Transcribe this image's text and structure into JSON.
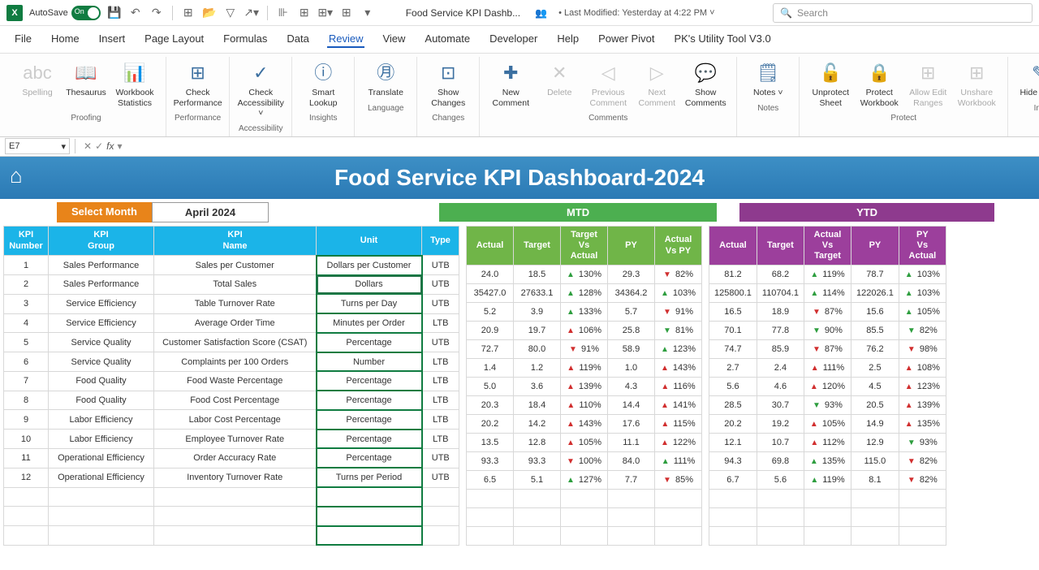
{
  "titlebar": {
    "autosave": "AutoSave",
    "doc": "Food Service KPI Dashb...",
    "lastmod": "• Last Modified: Yesterday at 4:22 PM",
    "search_ph": "Search"
  },
  "menu": [
    "File",
    "Home",
    "Insert",
    "Page Layout",
    "Formulas",
    "Data",
    "Review",
    "View",
    "Automate",
    "Developer",
    "Help",
    "Power Pivot",
    "PK's Utility Tool V3.0"
  ],
  "menu_active": "Review",
  "ribbon": {
    "groups": [
      {
        "label": "Proofing",
        "buttons": [
          {
            "icon": "abc",
            "label": "Spelling",
            "d": true
          },
          {
            "icon": "📖",
            "label": "Thesaurus"
          },
          {
            "icon": "📊",
            "label": "Workbook Statistics"
          }
        ]
      },
      {
        "label": "Performance",
        "buttons": [
          {
            "icon": "⊞",
            "label": "Check Performance"
          }
        ]
      },
      {
        "label": "Accessibility",
        "buttons": [
          {
            "icon": "✓",
            "label": "Check Accessibility ˅"
          }
        ]
      },
      {
        "label": "Insights",
        "buttons": [
          {
            "icon": "ⓘ",
            "label": "Smart Lookup"
          }
        ]
      },
      {
        "label": "Language",
        "buttons": [
          {
            "icon": "㊊",
            "label": "Translate"
          }
        ]
      },
      {
        "label": "Changes",
        "buttons": [
          {
            "icon": "⊡",
            "label": "Show Changes"
          }
        ]
      },
      {
        "label": "Comments",
        "buttons": [
          {
            "icon": "✚",
            "label": "New Comment"
          },
          {
            "icon": "✕",
            "label": "Delete",
            "d": true
          },
          {
            "icon": "◁",
            "label": "Previous Comment",
            "d": true
          },
          {
            "icon": "▷",
            "label": "Next Comment",
            "d": true
          },
          {
            "icon": "💬",
            "label": "Show Comments"
          }
        ]
      },
      {
        "label": "Notes",
        "buttons": [
          {
            "icon": "🗒",
            "label": "Notes ˅"
          }
        ]
      },
      {
        "label": "Protect",
        "buttons": [
          {
            "icon": "🔓",
            "label": "Unprotect Sheet"
          },
          {
            "icon": "🔒",
            "label": "Protect Workbook"
          },
          {
            "icon": "⊞",
            "label": "Allow Edit Ranges",
            "d": true
          },
          {
            "icon": "⊞",
            "label": "Unshare Workbook",
            "d": true
          }
        ]
      },
      {
        "label": "Ink",
        "buttons": [
          {
            "icon": "✎",
            "label": "Hide Ink ˅"
          }
        ]
      }
    ]
  },
  "namebox": "E7",
  "dash_title": "Food Service KPI Dashboard-2024",
  "select_month": "Select Month",
  "month": "April 2024",
  "mtd_label": "MTD",
  "ytd_label": "YTD",
  "left_cols": [
    "KPI Number",
    "KPI Group",
    "KPI Name",
    "Unit",
    "Type"
  ],
  "mtd_cols": [
    "Actual",
    "Target",
    "Target Vs Actual",
    "PY",
    "Actual Vs PY"
  ],
  "ytd_cols": [
    "Actual",
    "Target",
    "Actual Vs Target",
    "PY",
    "PY Vs Actual"
  ],
  "rows": [
    {
      "n": 1,
      "grp": "Sales Performance",
      "name": "Sales per Customer",
      "unit": "Dollars per Customer",
      "type": "UTB",
      "m": {
        "a": "24.0",
        "t": "18.5",
        "tva": "130%",
        "tvad": "u",
        "py": "29.3",
        "avpy": "82%",
        "avpyd": "d"
      },
      "y": {
        "a": "81.2",
        "t": "68.2",
        "avt": "119%",
        "avtd": "u",
        "py": "78.7",
        "pva": "103%",
        "pvad": "u"
      }
    },
    {
      "n": 2,
      "grp": "Sales Performance",
      "name": "Total Sales",
      "unit": "Dollars",
      "type": "UTB",
      "sel": true,
      "m": {
        "a": "35427.0",
        "t": "27633.1",
        "tva": "128%",
        "tvad": "u",
        "py": "34364.2",
        "avpy": "103%",
        "avpyd": "u"
      },
      "y": {
        "a": "125800.1",
        "t": "110704.1",
        "avt": "114%",
        "avtd": "u",
        "py": "122026.1",
        "pva": "103%",
        "pvad": "u"
      }
    },
    {
      "n": 3,
      "grp": "Service Efficiency",
      "name": "Table Turnover Rate",
      "unit": "Turns per Day",
      "type": "UTB",
      "m": {
        "a": "5.2",
        "t": "3.9",
        "tva": "133%",
        "tvad": "u",
        "py": "5.7",
        "avpy": "91%",
        "avpyd": "d"
      },
      "y": {
        "a": "16.5",
        "t": "18.9",
        "avt": "87%",
        "avtd": "d",
        "py": "15.6",
        "pva": "105%",
        "pvad": "u"
      }
    },
    {
      "n": 4,
      "grp": "Service Efficiency",
      "name": "Average Order Time",
      "unit": "Minutes per Order",
      "type": "LTB",
      "m": {
        "a": "20.9",
        "t": "19.7",
        "tva": "106%",
        "tvad": "dr",
        "py": "25.8",
        "avpy": "81%",
        "avpyd": "ug"
      },
      "y": {
        "a": "70.1",
        "t": "77.8",
        "avt": "90%",
        "avtd": "ug",
        "py": "85.5",
        "pva": "82%",
        "pvad": "ug"
      }
    },
    {
      "n": 5,
      "grp": "Service Quality",
      "name": "Customer Satisfaction Score (CSAT)",
      "unit": "Percentage",
      "type": "UTB",
      "m": {
        "a": "72.7",
        "t": "80.0",
        "tva": "91%",
        "tvad": "d",
        "py": "58.9",
        "avpy": "123%",
        "avpyd": "u"
      },
      "y": {
        "a": "74.7",
        "t": "85.9",
        "avt": "87%",
        "avtd": "d",
        "py": "76.2",
        "pva": "98%",
        "pvad": "d"
      }
    },
    {
      "n": 6,
      "grp": "Service Quality",
      "name": "Complaints per 100 Orders",
      "unit": "Number",
      "type": "LTB",
      "m": {
        "a": "1.4",
        "t": "1.2",
        "tva": "119%",
        "tvad": "dr",
        "py": "1.0",
        "avpy": "143%",
        "avpyd": "dr"
      },
      "y": {
        "a": "2.7",
        "t": "2.4",
        "avt": "111%",
        "avtd": "dr",
        "py": "2.5",
        "pva": "108%",
        "pvad": "dr"
      }
    },
    {
      "n": 7,
      "grp": "Food Quality",
      "name": "Food Waste Percentage",
      "unit": "Percentage",
      "type": "LTB",
      "m": {
        "a": "5.0",
        "t": "3.6",
        "tva": "139%",
        "tvad": "dr",
        "py": "4.3",
        "avpy": "116%",
        "avpyd": "dr"
      },
      "y": {
        "a": "5.6",
        "t": "4.6",
        "avt": "120%",
        "avtd": "dr",
        "py": "4.5",
        "pva": "123%",
        "pvad": "dr"
      }
    },
    {
      "n": 8,
      "grp": "Food Quality",
      "name": "Food Cost Percentage",
      "unit": "Percentage",
      "type": "LTB",
      "m": {
        "a": "20.3",
        "t": "18.4",
        "tva": "110%",
        "tvad": "dr",
        "py": "14.4",
        "avpy": "141%",
        "avpyd": "dr"
      },
      "y": {
        "a": "28.5",
        "t": "30.7",
        "avt": "93%",
        "avtd": "ug",
        "py": "20.5",
        "pva": "139%",
        "pvad": "dr"
      }
    },
    {
      "n": 9,
      "grp": "Labor Efficiency",
      "name": "Labor Cost Percentage",
      "unit": "Percentage",
      "type": "LTB",
      "m": {
        "a": "20.2",
        "t": "14.2",
        "tva": "143%",
        "tvad": "dr",
        "py": "17.6",
        "avpy": "115%",
        "avpyd": "dr"
      },
      "y": {
        "a": "20.2",
        "t": "19.2",
        "avt": "105%",
        "avtd": "dr",
        "py": "14.9",
        "pva": "135%",
        "pvad": "dr"
      }
    },
    {
      "n": 10,
      "grp": "Labor Efficiency",
      "name": "Employee Turnover Rate",
      "unit": "Percentage",
      "type": "LTB",
      "m": {
        "a": "13.5",
        "t": "12.8",
        "tva": "105%",
        "tvad": "dr",
        "py": "11.1",
        "avpy": "122%",
        "avpyd": "dr"
      },
      "y": {
        "a": "12.1",
        "t": "10.7",
        "avt": "112%",
        "avtd": "dr",
        "py": "12.9",
        "pva": "93%",
        "pvad": "ug"
      }
    },
    {
      "n": 11,
      "grp": "Operational Efficiency",
      "name": "Order Accuracy Rate",
      "unit": "Percentage",
      "type": "UTB",
      "m": {
        "a": "93.3",
        "t": "93.3",
        "tva": "100%",
        "tvad": "d",
        "py": "84.0",
        "avpy": "111%",
        "avpyd": "u"
      },
      "y": {
        "a": "94.3",
        "t": "69.8",
        "avt": "135%",
        "avtd": "u",
        "py": "115.0",
        "pva": "82%",
        "pvad": "d"
      }
    },
    {
      "n": 12,
      "grp": "Operational Efficiency",
      "name": "Inventory Turnover Rate",
      "unit": "Turns per Period",
      "type": "UTB",
      "m": {
        "a": "6.5",
        "t": "5.1",
        "tva": "127%",
        "tvad": "u",
        "py": "7.7",
        "avpy": "85%",
        "avpyd": "d"
      },
      "y": {
        "a": "6.7",
        "t": "5.6",
        "avt": "119%",
        "avtd": "u",
        "py": "8.1",
        "pva": "82%",
        "pvad": "d"
      }
    }
  ]
}
